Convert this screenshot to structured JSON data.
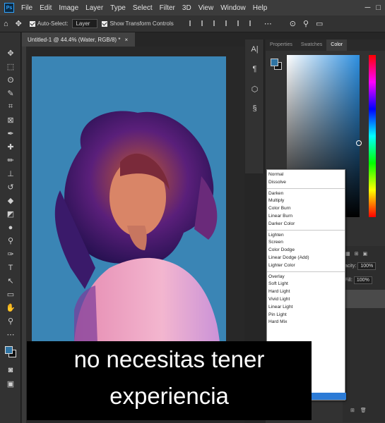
{
  "app": {
    "logo": "Ps"
  },
  "menu": [
    "File",
    "Edit",
    "Image",
    "Layer",
    "Type",
    "Select",
    "Filter",
    "3D",
    "View",
    "Window",
    "Help"
  ],
  "window_controls": [
    "─",
    "□"
  ],
  "options_bar": {
    "home_icon": "home-icon",
    "move_icon": "move-tool-icon",
    "auto_select_label": "Auto-Select:",
    "auto_select_value": "Layer",
    "show_transform_label": "Show Transform Controls"
  },
  "tools": [
    "move-icon",
    "marquee-icon",
    "lasso-icon",
    "quick-select-icon",
    "crop-icon",
    "frame-icon",
    "eyedropper-icon",
    "healing-icon",
    "brush-icon",
    "stamp-icon",
    "history-brush-icon",
    "eraser-icon",
    "bucket-icon",
    "blur-icon",
    "dodge-icon",
    "pen-icon",
    "type-icon",
    "path-select-icon",
    "rectangle-icon",
    "hand-icon",
    "zoom-icon",
    "more-icon"
  ],
  "tool_glyphs": [
    "✥",
    "⬚",
    "ʘ",
    "✎",
    "⌗",
    "⊠",
    "✒",
    "✚",
    "✏",
    "⊥",
    "↺",
    "◆",
    "◩",
    "●",
    "⚲",
    "✑",
    "T",
    "↖",
    "▭",
    "✋",
    "⚲",
    "⋯"
  ],
  "document": {
    "tab_title": "Untitled-1 @ 44.4% (Water, RGB/8) *",
    "close": "×"
  },
  "side_icons": [
    "A|",
    "¶",
    "⬡",
    "§"
  ],
  "panel": {
    "tabs": [
      "Properties",
      "Swatches",
      "Color"
    ],
    "active_tab": "Color",
    "foreground_color": "#2f74a3",
    "background_color": "#111111",
    "opacity_label": "acity:",
    "opacity_value": "100%",
    "fill_label": "Fill:",
    "fill_value": "100%"
  },
  "blend_modes": {
    "group1": [
      "Normal",
      "Dissolve"
    ],
    "group2": [
      "Darken",
      "Multiply",
      "Color Burn",
      "Linear Burn",
      "Darker Color"
    ],
    "group3": [
      "Lighten",
      "Screen",
      "Color Dodge",
      "Linear Dodge (Add)",
      "Lighter Color"
    ],
    "group4": [
      "Overlay",
      "Soft Light",
      "Hard Light",
      "Vivid Light",
      "Linear Light",
      "Pin Light",
      "Hard Mix"
    ]
  },
  "caption": {
    "line1": "no necesitas tener",
    "line2": "experiencia"
  }
}
